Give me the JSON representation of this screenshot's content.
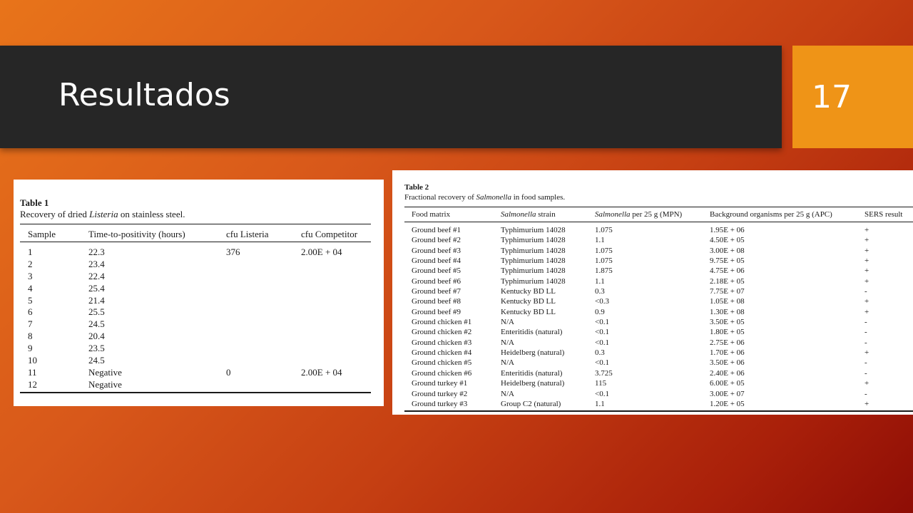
{
  "slide": {
    "title": "Resultados",
    "number": "17"
  },
  "table1": {
    "label": "Table 1",
    "caption_pre": "Recovery of dried ",
    "caption_em": "Listeria",
    "caption_post": " on stainless steel.",
    "headers": [
      "Sample",
      "Time-to-positivity (hours)",
      "cfu Listeria",
      "cfu Competitor"
    ],
    "rows": [
      [
        "1",
        "22.3",
        "376",
        "2.00E + 04"
      ],
      [
        "2",
        "23.4",
        "",
        ""
      ],
      [
        "3",
        "22.4",
        "",
        ""
      ],
      [
        "4",
        "25.4",
        "",
        ""
      ],
      [
        "5",
        "21.4",
        "",
        ""
      ],
      [
        "6",
        "25.5",
        "",
        ""
      ],
      [
        "7",
        "24.5",
        "",
        ""
      ],
      [
        "8",
        "20.4",
        "",
        ""
      ],
      [
        "9",
        "23.5",
        "",
        ""
      ],
      [
        "10",
        "24.5",
        "",
        ""
      ],
      [
        "11",
        "Negative",
        "0",
        "2.00E + 04"
      ],
      [
        "12",
        "Negative",
        "",
        ""
      ]
    ]
  },
  "table2": {
    "label": "Table 2",
    "caption_pre": "Fractional recovery of ",
    "caption_em": "Salmonella",
    "caption_post": " in food samples.",
    "headers": [
      {
        "em": "",
        "text": "Food matrix"
      },
      {
        "em": "Salmonella",
        "text": " strain"
      },
      {
        "em": "Salmonella",
        "text": " per 25 g (MPN)"
      },
      {
        "em": "",
        "text": "Background organisms per 25 g (APC)"
      },
      {
        "em": "",
        "text": "SERS result"
      }
    ],
    "rows": [
      [
        "Ground beef #1",
        "Typhimurium 14028",
        "1.075",
        "1.95E + 06",
        "+"
      ],
      [
        "Ground beef #2",
        "Typhimurium 14028",
        "1.1",
        "4.50E + 05",
        "+"
      ],
      [
        "Ground beef #3",
        "Typhimurium 14028",
        "1.075",
        "3.00E + 08",
        "+"
      ],
      [
        "Ground beef #4",
        "Typhimurium 14028",
        "1.075",
        "9.75E + 05",
        "+"
      ],
      [
        "Ground beef #5",
        "Typhimurium 14028",
        "1.875",
        "4.75E + 06",
        "+"
      ],
      [
        "Ground beef #6",
        "Typhimurium 14028",
        "1.1",
        "2.18E + 05",
        "+"
      ],
      [
        "Ground beef #7",
        "Kentucky BD LL",
        "0.3",
        "7.75E + 07",
        "-"
      ],
      [
        "Ground beef #8",
        "Kentucky BD LL",
        "<0.3",
        "1.05E + 08",
        "+"
      ],
      [
        "Ground beef #9",
        "Kentucky BD LL",
        "0.9",
        "1.30E + 08",
        "+"
      ],
      [
        "Ground chicken #1",
        "N/A",
        "<0.1",
        "3.50E + 05",
        "-"
      ],
      [
        "Ground chicken #2",
        "Enteritidis (natural)",
        "<0.1",
        "1.80E + 05",
        "-"
      ],
      [
        "Ground chicken #3",
        "N/A",
        "<0.1",
        "2.75E + 06",
        "-"
      ],
      [
        "Ground chicken #4",
        "Heidelberg (natural)",
        "0.3",
        "1.70E + 06",
        "+"
      ],
      [
        "Ground chicken #5",
        "N/A",
        "<0.1",
        "3.50E + 06",
        "-"
      ],
      [
        "Ground chicken #6",
        "Enteritidis (natural)",
        "3.725",
        "2.40E + 06",
        "-"
      ],
      [
        "Ground turkey #1",
        "Heidelberg (natural)",
        "115",
        "6.00E + 05",
        "+"
      ],
      [
        "Ground turkey #2",
        "N/A",
        "<0.1",
        "3.00E + 07",
        "-"
      ],
      [
        "Ground turkey #3",
        "Group C2 (natural)",
        "1.1",
        "1.20E + 05",
        "+"
      ]
    ]
  }
}
